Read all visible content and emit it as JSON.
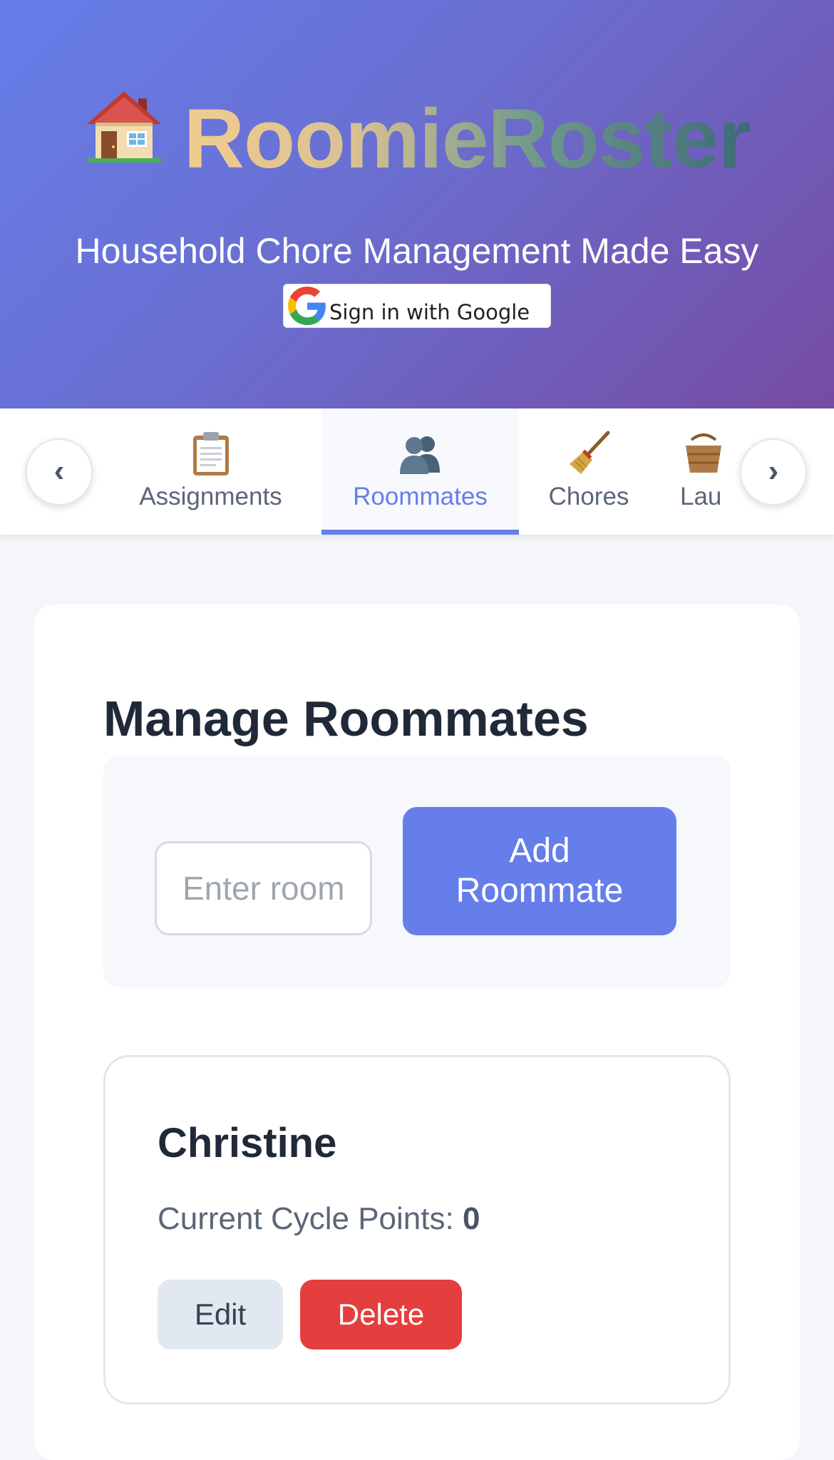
{
  "header": {
    "brand_icon": "house-icon",
    "brand_name": "RoomieRoster",
    "subtitle": "Household Chore Management Made Easy",
    "google_signin_label": "Sign in with Google"
  },
  "tabs": [
    {
      "icon": "clipboard-icon",
      "label": "Assignments",
      "active": false
    },
    {
      "icon": "people-icon",
      "label": "Roommates",
      "active": true
    },
    {
      "icon": "broom-icon",
      "label": "Chores",
      "active": false
    },
    {
      "icon": "basket-icon",
      "label": "Lau",
      "active": false
    }
  ],
  "tab_scroll": {
    "left": "‹",
    "right": "›"
  },
  "roommates_section": {
    "title": "Manage Roommates",
    "input_placeholder": "Enter roommate name",
    "add_button_label": "Add Roommate",
    "roommates": [
      {
        "name": "Christine",
        "points_label": "Current Cycle Points:",
        "points_value": "0",
        "edit_label": "Edit",
        "delete_label": "Delete"
      }
    ]
  },
  "colors": {
    "accent": "#667eea",
    "header_gradient_start": "#667eea",
    "header_gradient_end": "#764ba2",
    "danger": "#e53e3e"
  }
}
